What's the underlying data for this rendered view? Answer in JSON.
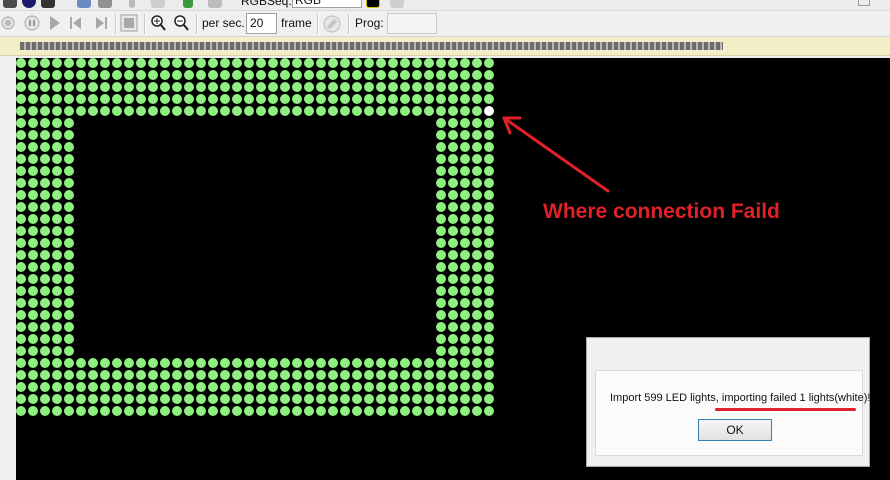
{
  "toolbar1": {
    "sequence_label": "RGBSeq..",
    "color_mode_value": "RGB"
  },
  "toolbar2": {
    "per_sec_label": "per sec.",
    "fps_value": "20",
    "frame_label": "frame",
    "prog_label": "Prog:",
    "prog_value": ""
  },
  "progress": {
    "fraction": 0.79
  },
  "led_grid": {
    "color": "#8ef07f",
    "failed_color": "#ffffff"
  },
  "annotation": {
    "text": "Where connection Faild",
    "color": "#e0212a"
  },
  "dialog": {
    "message": "Import 599 LED lights, importing failed 1 lights(white)!",
    "ok_label": "OK"
  },
  "icons": [
    "play-icon",
    "pause-icon",
    "stop-icon",
    "step-back-icon",
    "step-forward-icon",
    "zoom-in-icon",
    "zoom-out-icon",
    "record-icon"
  ]
}
